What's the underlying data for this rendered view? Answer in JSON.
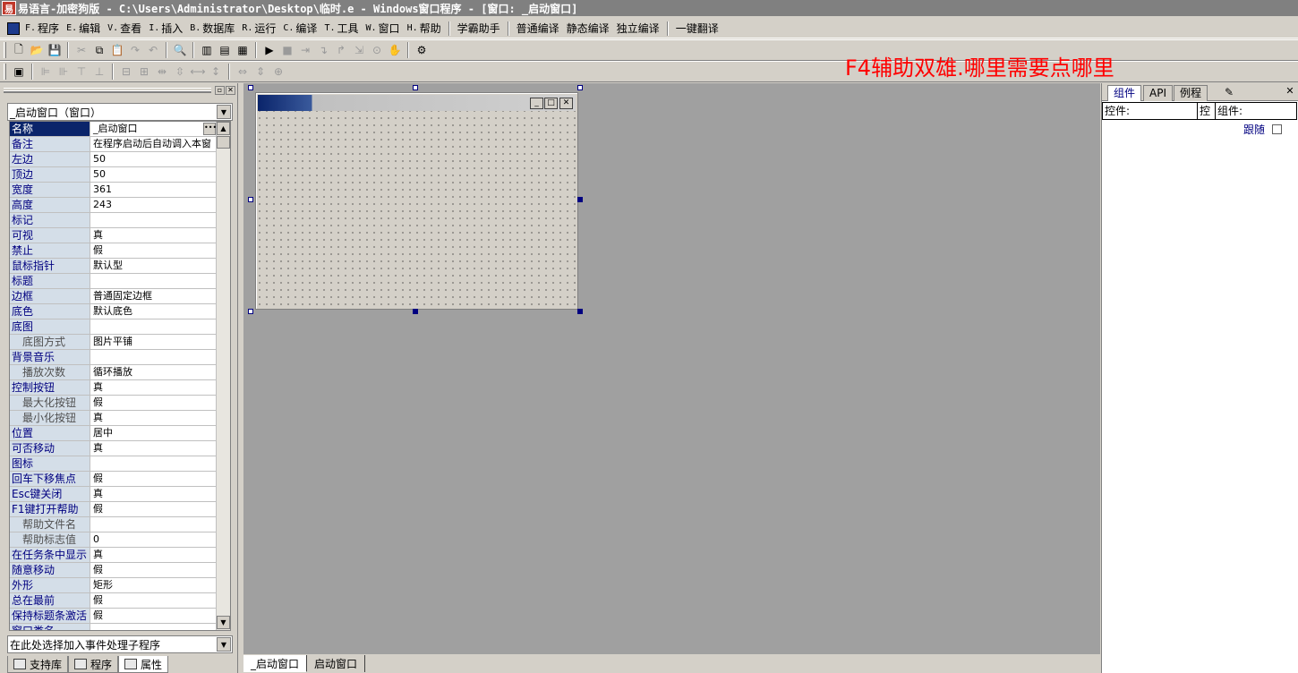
{
  "titlebar": {
    "app_icon": "app-icon",
    "title": "易语言-加密狗版 - C:\\Users\\Administrator\\Desktop\\临时.e - Windows窗口程序 - [窗口: _启动窗口]"
  },
  "menubar": {
    "items": [
      {
        "acc": "F.",
        "label": "程序"
      },
      {
        "acc": "E.",
        "label": "编辑"
      },
      {
        "acc": "V.",
        "label": "查看"
      },
      {
        "acc": "I.",
        "label": "插入"
      },
      {
        "acc": "B.",
        "label": "数据库"
      },
      {
        "acc": "R.",
        "label": "运行"
      },
      {
        "acc": "C.",
        "label": "编译"
      },
      {
        "acc": "T.",
        "label": "工具"
      },
      {
        "acc": "W.",
        "label": "窗口"
      },
      {
        "acc": "H.",
        "label": "帮助"
      }
    ],
    "extras": [
      "学霸助手",
      "普通编译",
      "静态编译",
      "独立编译",
      "一键翻译"
    ]
  },
  "hint_text": "F4辅助双雄.哪里需要点哪里",
  "left_panel": {
    "object_combo": "_启动窗口（窗口）",
    "event_combo": "在此处选择加入事件处理子程序",
    "properties": [
      {
        "name": "名称",
        "value": "_启动窗口",
        "selected": true
      },
      {
        "name": "备注",
        "value": "在程序启动后自动调入本窗"
      },
      {
        "name": "左边",
        "value": "50"
      },
      {
        "name": "顶边",
        "value": "50"
      },
      {
        "name": "宽度",
        "value": "361"
      },
      {
        "name": "高度",
        "value": "243"
      },
      {
        "name": "标记",
        "value": ""
      },
      {
        "name": "可视",
        "value": "真"
      },
      {
        "name": "禁止",
        "value": "假"
      },
      {
        "name": "鼠标指针",
        "value": "默认型"
      },
      {
        "name": "标题",
        "value": ""
      },
      {
        "name": "边框",
        "value": "普通固定边框"
      },
      {
        "name": "底色",
        "value": "默认底色"
      },
      {
        "name": "底图",
        "value": ""
      },
      {
        "name": "底图方式",
        "value": "图片平铺",
        "sub": true
      },
      {
        "name": "背景音乐",
        "value": ""
      },
      {
        "name": "播放次数",
        "value": "循环播放",
        "sub": true
      },
      {
        "name": "控制按钮",
        "value": "真"
      },
      {
        "name": "最大化按钮",
        "value": "假",
        "sub": true
      },
      {
        "name": "最小化按钮",
        "value": "真",
        "sub": true
      },
      {
        "name": "位置",
        "value": "居中"
      },
      {
        "name": "可否移动",
        "value": "真"
      },
      {
        "name": "图标",
        "value": ""
      },
      {
        "name": "回车下移焦点",
        "value": "假"
      },
      {
        "name": "Esc键关闭",
        "value": "真"
      },
      {
        "name": "F1键打开帮助",
        "value": "假"
      },
      {
        "name": "帮助文件名",
        "value": "",
        "sub": true
      },
      {
        "name": "帮助标志值",
        "value": "0",
        "sub": true
      },
      {
        "name": "在任务条中显示",
        "value": "真"
      },
      {
        "name": "随意移动",
        "value": "假"
      },
      {
        "name": "外形",
        "value": "矩形"
      },
      {
        "name": "总在最前",
        "value": "假"
      },
      {
        "name": "保持标题条激活",
        "value": "假"
      },
      {
        "name": "窗口类名",
        "value": ""
      }
    ],
    "tabs": [
      {
        "label": "支持库",
        "icon": "library-icon"
      },
      {
        "label": "程序",
        "icon": "program-icon"
      },
      {
        "label": "属性",
        "icon": "properties-icon",
        "active": true
      }
    ]
  },
  "design_area": {
    "tabs": [
      {
        "label": "_启动窗口",
        "active": true
      },
      {
        "label": "启动窗口"
      }
    ]
  },
  "right_panel": {
    "tabs": [
      "组件",
      "API",
      "例程"
    ],
    "control_label": "控件:",
    "control_short": "控",
    "component_label": "组件:",
    "follow_label": "跟随"
  },
  "colors": {
    "hint": "#ff0000",
    "selection": "#0a246a",
    "canvas": "#a0a0a0"
  }
}
